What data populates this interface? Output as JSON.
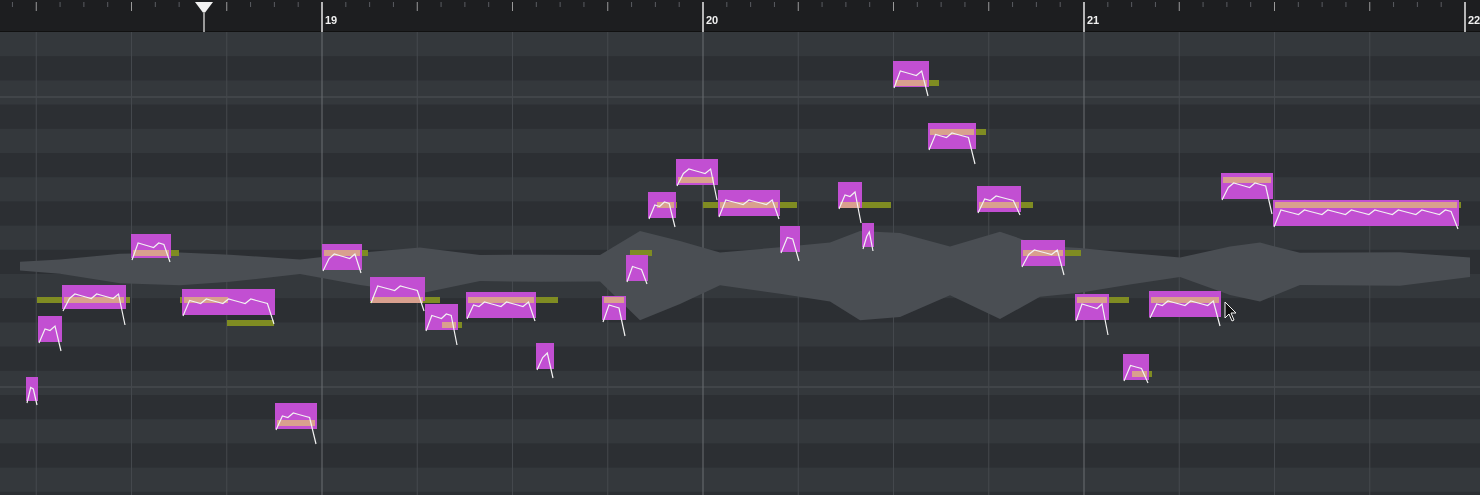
{
  "ruler": {
    "bar_numbers": [
      "19",
      "20",
      "21",
      "22"
    ]
  }
}
